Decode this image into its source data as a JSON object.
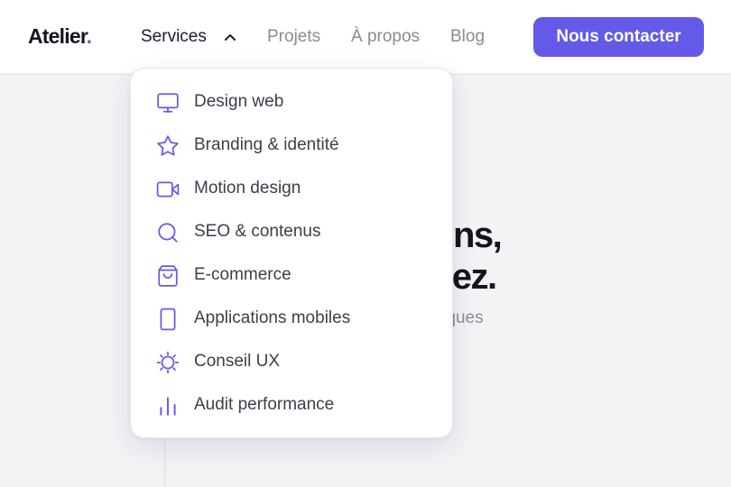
{
  "brand": {
    "name": "Atelier",
    "dot": ".",
    "accent": "#6559e8"
  },
  "nav": {
    "items": [
      {
        "label": "Services",
        "active": true,
        "expanded": true
      },
      {
        "label": "Projets"
      },
      {
        "label": "À propos"
      },
      {
        "label": "Blog"
      }
    ],
    "cta_label": "Nous contacter"
  },
  "services_menu": [
    {
      "label": "Design web",
      "icon": "monitor-icon"
    },
    {
      "label": "Branding & identité",
      "icon": "star-icon"
    },
    {
      "label": "Motion design",
      "icon": "video-camera-icon"
    },
    {
      "label": "SEO & contenus",
      "icon": "search-icon"
    },
    {
      "label": "E-commerce",
      "icon": "shopping-bag-icon"
    },
    {
      "label": "Applications mobiles",
      "icon": "smartphone-icon"
    },
    {
      "label": "Conseil UX",
      "icon": "sun-icon"
    },
    {
      "label": "Audit performance",
      "icon": "bar-chart-icon"
    }
  ],
  "hero": {
    "line1_tail": "ns,",
    "line2_tail": "sez.",
    "sub_tail": "ques"
  },
  "colors": {
    "icon": "#6559e8",
    "text_dark": "#15151f",
    "text_muted": "#8a8a93",
    "background": "#f3f3f6"
  }
}
